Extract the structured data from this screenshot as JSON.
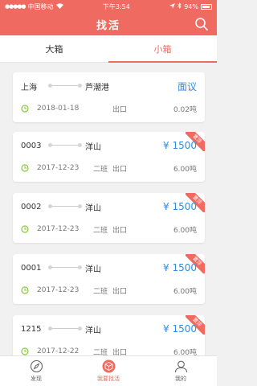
{
  "status_bar": {
    "carrier": "中国移动",
    "time": "下午3:54",
    "battery": "94%"
  },
  "nav": {
    "title": "找活"
  },
  "tabs": [
    {
      "label": "大箱",
      "active": false
    },
    {
      "label": "小箱",
      "active": true
    }
  ],
  "cards": [
    {
      "origin": "上海",
      "dest": "芦潮港",
      "price": "面议",
      "date": "2018-01-18",
      "shift": "",
      "io": "出口",
      "weight": "0.02吨",
      "badge": ""
    },
    {
      "origin": "0003",
      "dest": "洋山",
      "price": "¥ 1500",
      "date": "2017-12-23",
      "shift": "二班",
      "io": "出口",
      "weight": "6.00吨",
      "badge": "置顶"
    },
    {
      "origin": "0002",
      "dest": "洋山",
      "price": "¥ 1500",
      "date": "2017-12-23",
      "shift": "二班",
      "io": "出口",
      "weight": "6.00吨",
      "badge": "置顶"
    },
    {
      "origin": "0001",
      "dest": "洋山",
      "price": "¥ 1500",
      "date": "2017-12-23",
      "shift": "二班",
      "io": "出口",
      "weight": "6.00吨",
      "badge": "置顶"
    },
    {
      "origin": "1215",
      "dest": "洋山",
      "price": "¥ 1500",
      "date": "2017-12-22",
      "shift": "二班",
      "io": "出口",
      "weight": "6.00吨",
      "badge": "置顶"
    }
  ],
  "tabbar": [
    {
      "label": "发现",
      "icon": "compass-icon"
    },
    {
      "label": "我要找活",
      "icon": "box-icon"
    },
    {
      "label": "我的",
      "icon": "user-icon"
    }
  ],
  "colors": {
    "accent": "#ef6b61",
    "price": "#2e8de0"
  }
}
